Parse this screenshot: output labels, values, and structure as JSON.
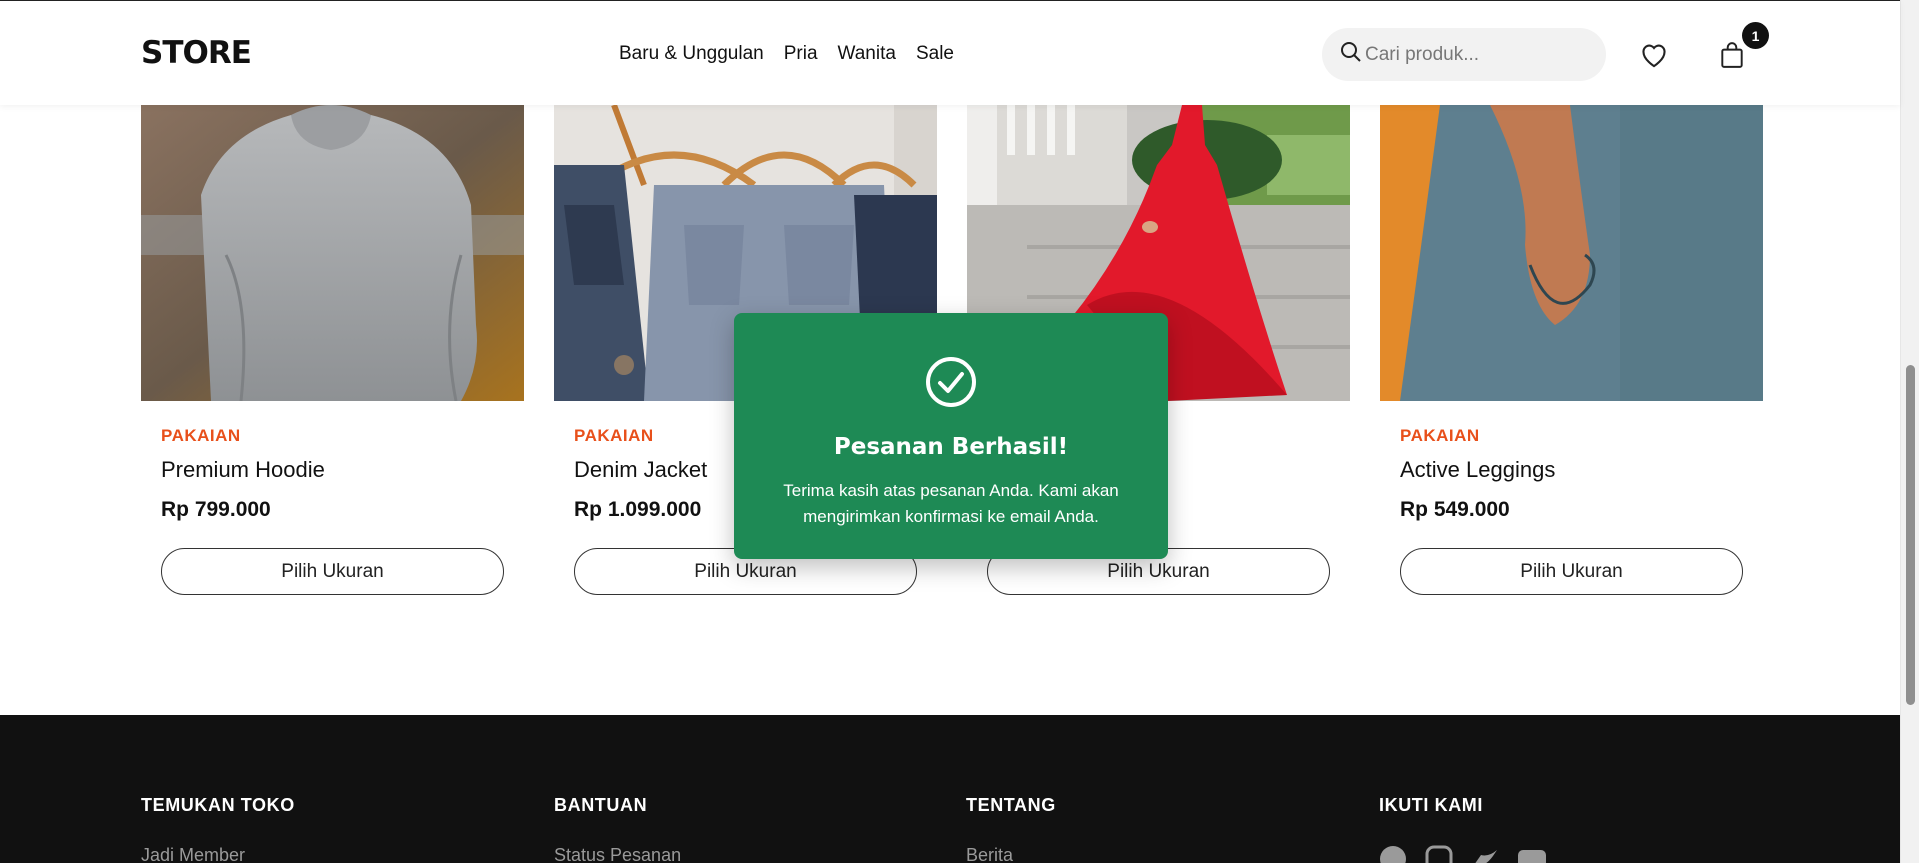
{
  "header": {
    "logo": "STORE",
    "nav": [
      "Baru & Unggulan",
      "Pria",
      "Wanita",
      "Sale"
    ],
    "search_placeholder": "Cari produk...",
    "cart_count": "1"
  },
  "products": [
    {
      "category": "PAKAIAN",
      "name": "Premium Hoodie",
      "price": "Rp 799.000",
      "button": "Pilih Ukuran"
    },
    {
      "category": "PAKAIAN",
      "name": "Denim Jacket",
      "price": "Rp 1.099.000",
      "button": "Pilih Ukuran"
    },
    {
      "category": "",
      "name": "",
      "price": "",
      "button": "Pilih Ukuran"
    },
    {
      "category": "PAKAIAN",
      "name": "Active Leggings",
      "price": "Rp 549.000",
      "button": "Pilih Ukuran"
    }
  ],
  "toast": {
    "title": "Pesanan Berhasil!",
    "message": "Terima kasih atas pesanan Anda. Kami akan mengirimkan konfirmasi ke email Anda."
  },
  "footer": {
    "columns": [
      {
        "title": "TEMUKAN TOKO",
        "link": "Jadi Member"
      },
      {
        "title": "BANTUAN",
        "link": "Status Pesanan"
      },
      {
        "title": "TENTANG",
        "link": "Berita"
      },
      {
        "title": "IKUTI KAMI",
        "link": ""
      }
    ],
    "socials": [
      "facebook-icon",
      "instagram-icon",
      "twitter-icon",
      "youtube-icon"
    ]
  },
  "colors": {
    "accent": "#e8501b",
    "toast": "#1e8a55",
    "footer": "#111111"
  }
}
